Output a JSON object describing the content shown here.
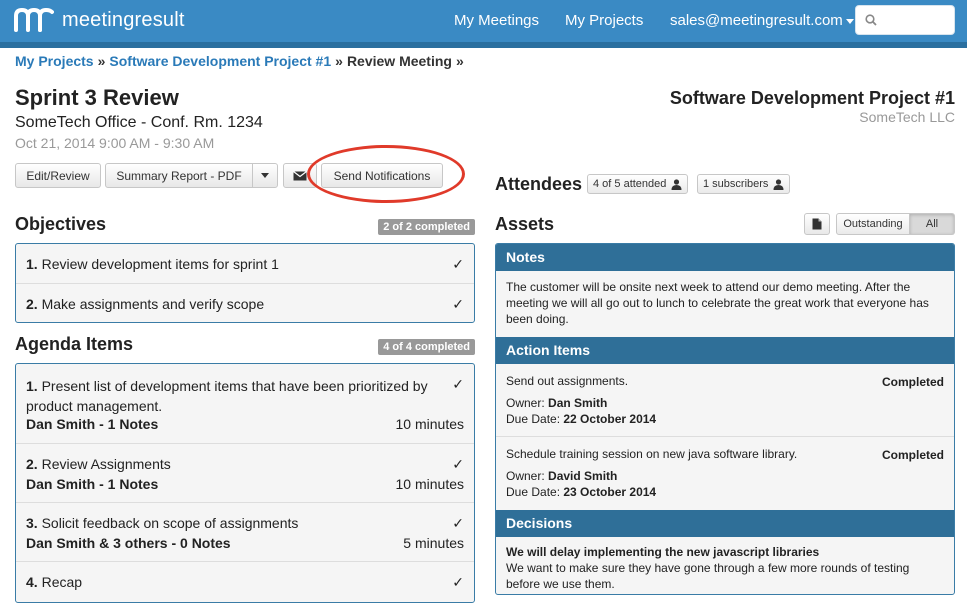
{
  "header": {
    "logo_text": "meetingresult",
    "nav": {
      "my_meetings": "My Meetings",
      "my_projects": "My Projects",
      "user_email": "sales@meetingresult.com"
    },
    "search_placeholder": ""
  },
  "breadcrumb": {
    "items": [
      "My Projects",
      "Software Development Project #1",
      "Review Meeting"
    ],
    "separator": "»"
  },
  "meeting": {
    "title": "Sprint 3 Review",
    "location": "SomeTech Office - Conf. Rm. 1234",
    "time": "Oct 21, 2014 9:00 AM - 9:30 AM"
  },
  "project": {
    "title": "Software Development Project #1",
    "company": "SomeTech LLC"
  },
  "toolbar": {
    "edit_review": "Edit/Review",
    "summary_report": "Summary Report - PDF",
    "send_notifications": "Send Notifications"
  },
  "attendees": {
    "title": "Attendees",
    "attended": "4 of 5 attended",
    "subscribers": "1 subscribers"
  },
  "objectives": {
    "title": "Objectives",
    "badge": "2 of 2 completed",
    "items": [
      {
        "num": "1.",
        "text": "Review development items for sprint 1",
        "check": "✓"
      },
      {
        "num": "2.",
        "text": "Make assignments and verify scope",
        "check": "✓"
      }
    ]
  },
  "agenda": {
    "title": "Agenda Items",
    "badge": "4 of 4 completed",
    "items": [
      {
        "num": "1.",
        "text1": "Present list of development items that have been prioritized by",
        "text2": "product management.",
        "owner": "Dan Smith - 1 Notes",
        "duration": "10 minutes",
        "check": "✓"
      },
      {
        "num": "2.",
        "text1": "Review Assignments",
        "owner": "Dan Smith - 1 Notes",
        "duration": "10 minutes",
        "check": "✓"
      },
      {
        "num": "3.",
        "text1": "Solicit feedback on scope of assignments",
        "owner": "Dan Smith & 3 others - 0 Notes",
        "duration": "5 minutes",
        "check": "✓"
      },
      {
        "num": "4.",
        "text1": "Recap",
        "check": "✓"
      }
    ]
  },
  "assets": {
    "title": "Assets",
    "filter_outstanding": "Outstanding",
    "filter_all": "All",
    "notes": {
      "header": "Notes",
      "line1": "The customer will be onsite next week to attend our demo meeting.  After the",
      "line2": "meeting we will all go out to lunch to celebrate the great work that everyone has",
      "line3": "been doing."
    },
    "action_items": {
      "header": "Action Items",
      "owner_label": "Owner:",
      "due_label": "Due Date:",
      "items": [
        {
          "text": "Send out assignments.",
          "status": "Completed",
          "owner": "Dan Smith",
          "due": "22 October 2014"
        },
        {
          "text": "Schedule training session on new java software library.",
          "status": "Completed",
          "owner": "David Smith",
          "due": "23 October 2014"
        }
      ]
    },
    "decisions": {
      "header": "Decisions",
      "title": "We will delay implementing the new javascript libraries",
      "line1": "We want to make sure they have gone through a few more rounds of testing",
      "line2": "before we use them."
    }
  },
  "colors": {
    "nav_bg": "#3a8ac4",
    "panel_header": "#2f6f98",
    "link": "#2a7ab8",
    "highlight_ellipse": "#e03a2a"
  }
}
